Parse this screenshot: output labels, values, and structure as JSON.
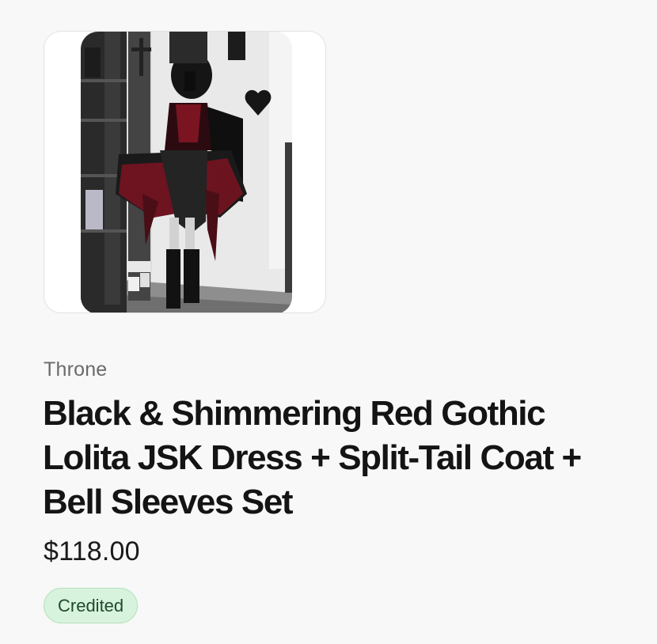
{
  "product": {
    "image_alt": "Black & Shimmering Red Gothic Lolita JSK Dress + Split-Tail Coat + Bell Sleeves Set",
    "brand": "Throne",
    "title": "Black & Shimmering Red Gothic Lolita JSK Dress + Split-Tail Coat + Bell Sleeves Set",
    "price": "$118.00",
    "status": "Credited"
  },
  "colors": {
    "badge_background": "#d8f3dd",
    "badge_text": "#1e4a2a",
    "dress_red": "#7a1420"
  }
}
